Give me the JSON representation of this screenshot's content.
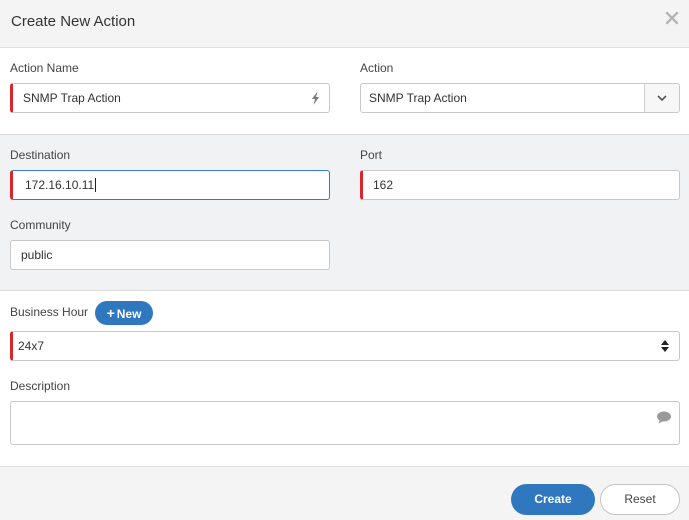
{
  "dialog": {
    "title": "Create New Action",
    "close_icon": "close-icon"
  },
  "action_name": {
    "label": "Action Name",
    "value": "SNMP Trap Action",
    "icon": "lightning-icon",
    "required": true
  },
  "action": {
    "label": "Action",
    "selected": "SNMP Trap Action",
    "icon": "chevron-down-icon"
  },
  "destination": {
    "label": "Destination",
    "value": "172.16.10.11",
    "required": true,
    "focused": true
  },
  "port": {
    "label": "Port",
    "value": "162",
    "required": true
  },
  "community": {
    "label": "Community",
    "value": "public"
  },
  "business_hour": {
    "label": "Business Hour",
    "new_button": "New",
    "selected": "24x7",
    "icon": "sort-arrows-icon",
    "required": true
  },
  "description": {
    "label": "Description",
    "value": "",
    "icon": "comment-icon"
  },
  "footer": {
    "create_label": "Create",
    "reset_label": "Reset"
  },
  "colors": {
    "primary": "#2f78c0",
    "required_marker": "#d9262c",
    "section_bg": "#f1f2f4"
  }
}
